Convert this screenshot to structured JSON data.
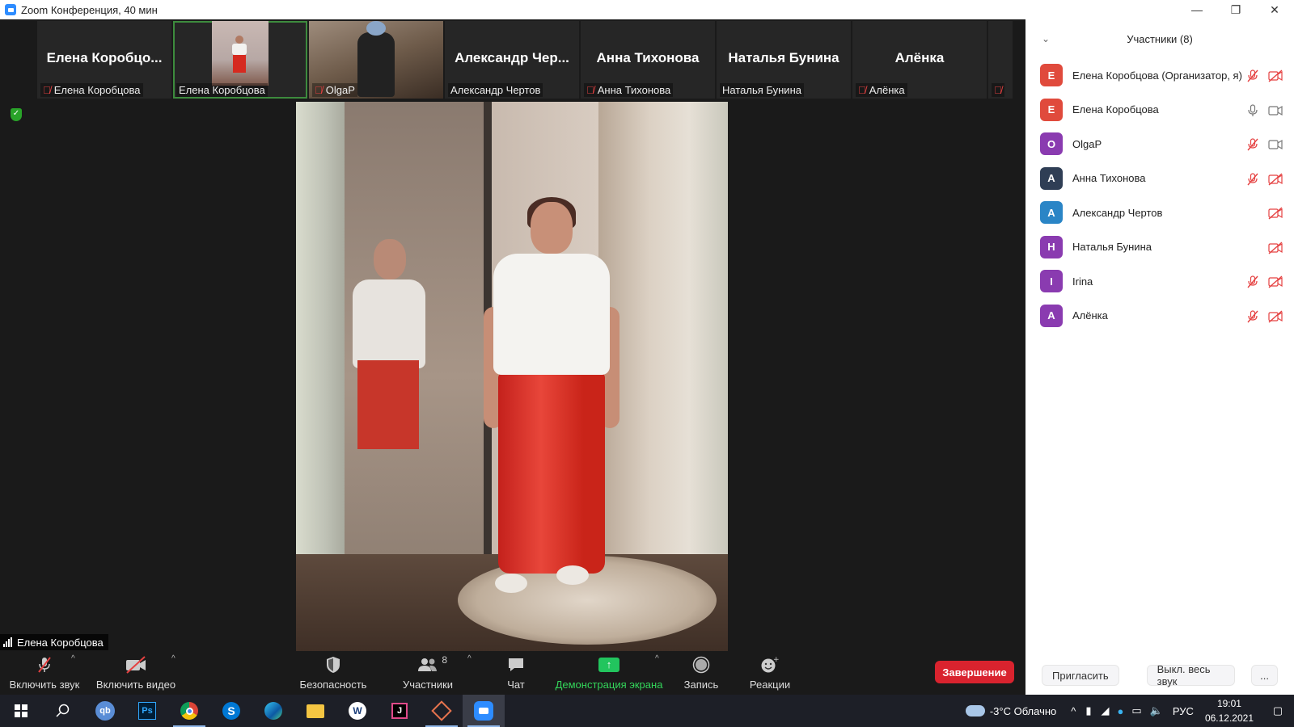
{
  "window": {
    "title": "Zoom Конференция, 40 мин",
    "minimize": "—",
    "maximize": "❐",
    "close": "✕"
  },
  "thumbnails": [
    {
      "big_name": "Елена  Коробцо...",
      "label": "Елена Коробцова",
      "muted": true,
      "video": false
    },
    {
      "big_name": "",
      "label": "Елена Коробцова",
      "muted": false,
      "video": true,
      "active": true
    },
    {
      "big_name": "",
      "label": "OlgaP",
      "muted": true,
      "video": true
    },
    {
      "big_name": "Александр  Чер...",
      "label": "Александр Чертов",
      "muted": false,
      "video": false
    },
    {
      "big_name": "Анна Тихонова",
      "label": "Анна Тихонова",
      "muted": true,
      "video": false
    },
    {
      "big_name": "Наталья Бунина",
      "label": "Наталья Бунина",
      "muted": false,
      "video": false
    },
    {
      "big_name": "Алёнка",
      "label": "Алёнка",
      "muted": true,
      "video": false
    }
  ],
  "speaker": {
    "name": "Елена Коробцова"
  },
  "toolbar": {
    "unmute_label": "Включить звук",
    "video_label": "Включить видео",
    "security_label": "Безопасность",
    "participants_label": "Участники",
    "participants_count": "8",
    "chat_label": "Чат",
    "share_label": "Демонстрация экрана",
    "record_label": "Запись",
    "reactions_label": "Реакции",
    "end_label": "Завершение"
  },
  "panel": {
    "title": "Участники (8)",
    "participants": [
      {
        "initial": "Е",
        "name": "Елена Коробцова (Организатор, я)",
        "color": "#e04a3c",
        "mic": "muted",
        "cam": "off"
      },
      {
        "initial": "Е",
        "name": "Елена Коробцова",
        "color": "#e04a3c",
        "mic": "on",
        "cam": "on"
      },
      {
        "initial": "O",
        "name": "OlgaP",
        "color": "#8a3bb0",
        "mic": "muted",
        "cam": "on"
      },
      {
        "initial": "А",
        "name": "Анна Тихонова",
        "color": "#2f3e55",
        "mic": "muted",
        "cam": "off"
      },
      {
        "initial": "А",
        "name": "Александр Чертов",
        "color": "#2a85c6",
        "mic": "none",
        "cam": "off"
      },
      {
        "initial": "Н",
        "name": "Наталья Бунина",
        "color": "#8a3bb0",
        "mic": "none",
        "cam": "off"
      },
      {
        "initial": "I",
        "name": "Irina",
        "color": "#8a3bb0",
        "mic": "muted",
        "cam": "off"
      },
      {
        "initial": "А",
        "name": "Алёнка",
        "color": "#8a3bb0",
        "mic": "muted",
        "cam": "off"
      }
    ],
    "invite_label": "Пригласить",
    "mute_all_label": "Выкл. весь звук",
    "more_label": "..."
  },
  "taskbar": {
    "weather": "-3°C  Облачно",
    "lang": "РУС",
    "time": "19:01",
    "date": "06.12.2021",
    "apps": [
      "start-icon",
      "search-icon",
      "qbittorrent-icon",
      "photoshop-icon",
      "chrome-icon",
      "skype-icon",
      "edge-icon",
      "explorer-icon",
      "word-icon",
      "jetbrains-icon",
      "app-icon",
      "zoom-icon"
    ]
  },
  "colors": {
    "accent_green": "#33d65a",
    "end_red": "#d9232e",
    "mute_red": "#e54141"
  }
}
